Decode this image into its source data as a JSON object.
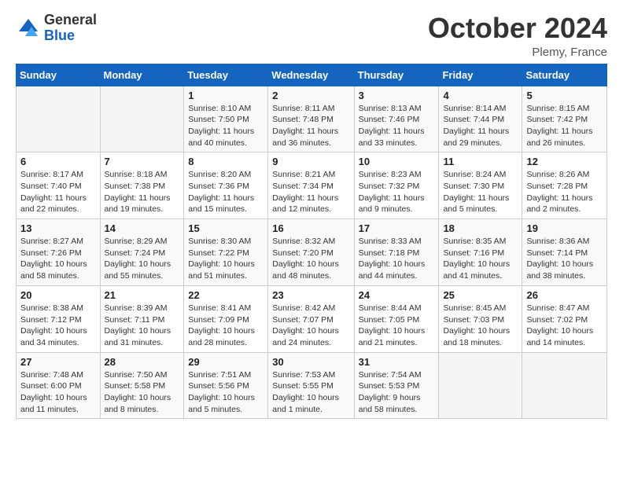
{
  "logo": {
    "general": "General",
    "blue": "Blue"
  },
  "title": "October 2024",
  "location": "Plemy, France",
  "days_header": [
    "Sunday",
    "Monday",
    "Tuesday",
    "Wednesday",
    "Thursday",
    "Friday",
    "Saturday"
  ],
  "weeks": [
    [
      {
        "num": "",
        "sunrise": "",
        "sunset": "",
        "daylight": "",
        "empty": true
      },
      {
        "num": "",
        "sunrise": "",
        "sunset": "",
        "daylight": "",
        "empty": true
      },
      {
        "num": "1",
        "sunrise": "Sunrise: 8:10 AM",
        "sunset": "Sunset: 7:50 PM",
        "daylight": "Daylight: 11 hours and 40 minutes."
      },
      {
        "num": "2",
        "sunrise": "Sunrise: 8:11 AM",
        "sunset": "Sunset: 7:48 PM",
        "daylight": "Daylight: 11 hours and 36 minutes."
      },
      {
        "num": "3",
        "sunrise": "Sunrise: 8:13 AM",
        "sunset": "Sunset: 7:46 PM",
        "daylight": "Daylight: 11 hours and 33 minutes."
      },
      {
        "num": "4",
        "sunrise": "Sunrise: 8:14 AM",
        "sunset": "Sunset: 7:44 PM",
        "daylight": "Daylight: 11 hours and 29 minutes."
      },
      {
        "num": "5",
        "sunrise": "Sunrise: 8:15 AM",
        "sunset": "Sunset: 7:42 PM",
        "daylight": "Daylight: 11 hours and 26 minutes."
      }
    ],
    [
      {
        "num": "6",
        "sunrise": "Sunrise: 8:17 AM",
        "sunset": "Sunset: 7:40 PM",
        "daylight": "Daylight: 11 hours and 22 minutes."
      },
      {
        "num": "7",
        "sunrise": "Sunrise: 8:18 AM",
        "sunset": "Sunset: 7:38 PM",
        "daylight": "Daylight: 11 hours and 19 minutes."
      },
      {
        "num": "8",
        "sunrise": "Sunrise: 8:20 AM",
        "sunset": "Sunset: 7:36 PM",
        "daylight": "Daylight: 11 hours and 15 minutes."
      },
      {
        "num": "9",
        "sunrise": "Sunrise: 8:21 AM",
        "sunset": "Sunset: 7:34 PM",
        "daylight": "Daylight: 11 hours and 12 minutes."
      },
      {
        "num": "10",
        "sunrise": "Sunrise: 8:23 AM",
        "sunset": "Sunset: 7:32 PM",
        "daylight": "Daylight: 11 hours and 9 minutes."
      },
      {
        "num": "11",
        "sunrise": "Sunrise: 8:24 AM",
        "sunset": "Sunset: 7:30 PM",
        "daylight": "Daylight: 11 hours and 5 minutes."
      },
      {
        "num": "12",
        "sunrise": "Sunrise: 8:26 AM",
        "sunset": "Sunset: 7:28 PM",
        "daylight": "Daylight: 11 hours and 2 minutes."
      }
    ],
    [
      {
        "num": "13",
        "sunrise": "Sunrise: 8:27 AM",
        "sunset": "Sunset: 7:26 PM",
        "daylight": "Daylight: 10 hours and 58 minutes."
      },
      {
        "num": "14",
        "sunrise": "Sunrise: 8:29 AM",
        "sunset": "Sunset: 7:24 PM",
        "daylight": "Daylight: 10 hours and 55 minutes."
      },
      {
        "num": "15",
        "sunrise": "Sunrise: 8:30 AM",
        "sunset": "Sunset: 7:22 PM",
        "daylight": "Daylight: 10 hours and 51 minutes."
      },
      {
        "num": "16",
        "sunrise": "Sunrise: 8:32 AM",
        "sunset": "Sunset: 7:20 PM",
        "daylight": "Daylight: 10 hours and 48 minutes."
      },
      {
        "num": "17",
        "sunrise": "Sunrise: 8:33 AM",
        "sunset": "Sunset: 7:18 PM",
        "daylight": "Daylight: 10 hours and 44 minutes."
      },
      {
        "num": "18",
        "sunrise": "Sunrise: 8:35 AM",
        "sunset": "Sunset: 7:16 PM",
        "daylight": "Daylight: 10 hours and 41 minutes."
      },
      {
        "num": "19",
        "sunrise": "Sunrise: 8:36 AM",
        "sunset": "Sunset: 7:14 PM",
        "daylight": "Daylight: 10 hours and 38 minutes."
      }
    ],
    [
      {
        "num": "20",
        "sunrise": "Sunrise: 8:38 AM",
        "sunset": "Sunset: 7:12 PM",
        "daylight": "Daylight: 10 hours and 34 minutes."
      },
      {
        "num": "21",
        "sunrise": "Sunrise: 8:39 AM",
        "sunset": "Sunset: 7:11 PM",
        "daylight": "Daylight: 10 hours and 31 minutes."
      },
      {
        "num": "22",
        "sunrise": "Sunrise: 8:41 AM",
        "sunset": "Sunset: 7:09 PM",
        "daylight": "Daylight: 10 hours and 28 minutes."
      },
      {
        "num": "23",
        "sunrise": "Sunrise: 8:42 AM",
        "sunset": "Sunset: 7:07 PM",
        "daylight": "Daylight: 10 hours and 24 minutes."
      },
      {
        "num": "24",
        "sunrise": "Sunrise: 8:44 AM",
        "sunset": "Sunset: 7:05 PM",
        "daylight": "Daylight: 10 hours and 21 minutes."
      },
      {
        "num": "25",
        "sunrise": "Sunrise: 8:45 AM",
        "sunset": "Sunset: 7:03 PM",
        "daylight": "Daylight: 10 hours and 18 minutes."
      },
      {
        "num": "26",
        "sunrise": "Sunrise: 8:47 AM",
        "sunset": "Sunset: 7:02 PM",
        "daylight": "Daylight: 10 hours and 14 minutes."
      }
    ],
    [
      {
        "num": "27",
        "sunrise": "Sunrise: 7:48 AM",
        "sunset": "Sunset: 6:00 PM",
        "daylight": "Daylight: 10 hours and 11 minutes."
      },
      {
        "num": "28",
        "sunrise": "Sunrise: 7:50 AM",
        "sunset": "Sunset: 5:58 PM",
        "daylight": "Daylight: 10 hours and 8 minutes."
      },
      {
        "num": "29",
        "sunrise": "Sunrise: 7:51 AM",
        "sunset": "Sunset: 5:56 PM",
        "daylight": "Daylight: 10 hours and 5 minutes."
      },
      {
        "num": "30",
        "sunrise": "Sunrise: 7:53 AM",
        "sunset": "Sunset: 5:55 PM",
        "daylight": "Daylight: 10 hours and 1 minute."
      },
      {
        "num": "31",
        "sunrise": "Sunrise: 7:54 AM",
        "sunset": "Sunset: 5:53 PM",
        "daylight": "Daylight: 9 hours and 58 minutes."
      },
      {
        "num": "",
        "sunrise": "",
        "sunset": "",
        "daylight": "",
        "empty": true
      },
      {
        "num": "",
        "sunrise": "",
        "sunset": "",
        "daylight": "",
        "empty": true
      }
    ]
  ]
}
